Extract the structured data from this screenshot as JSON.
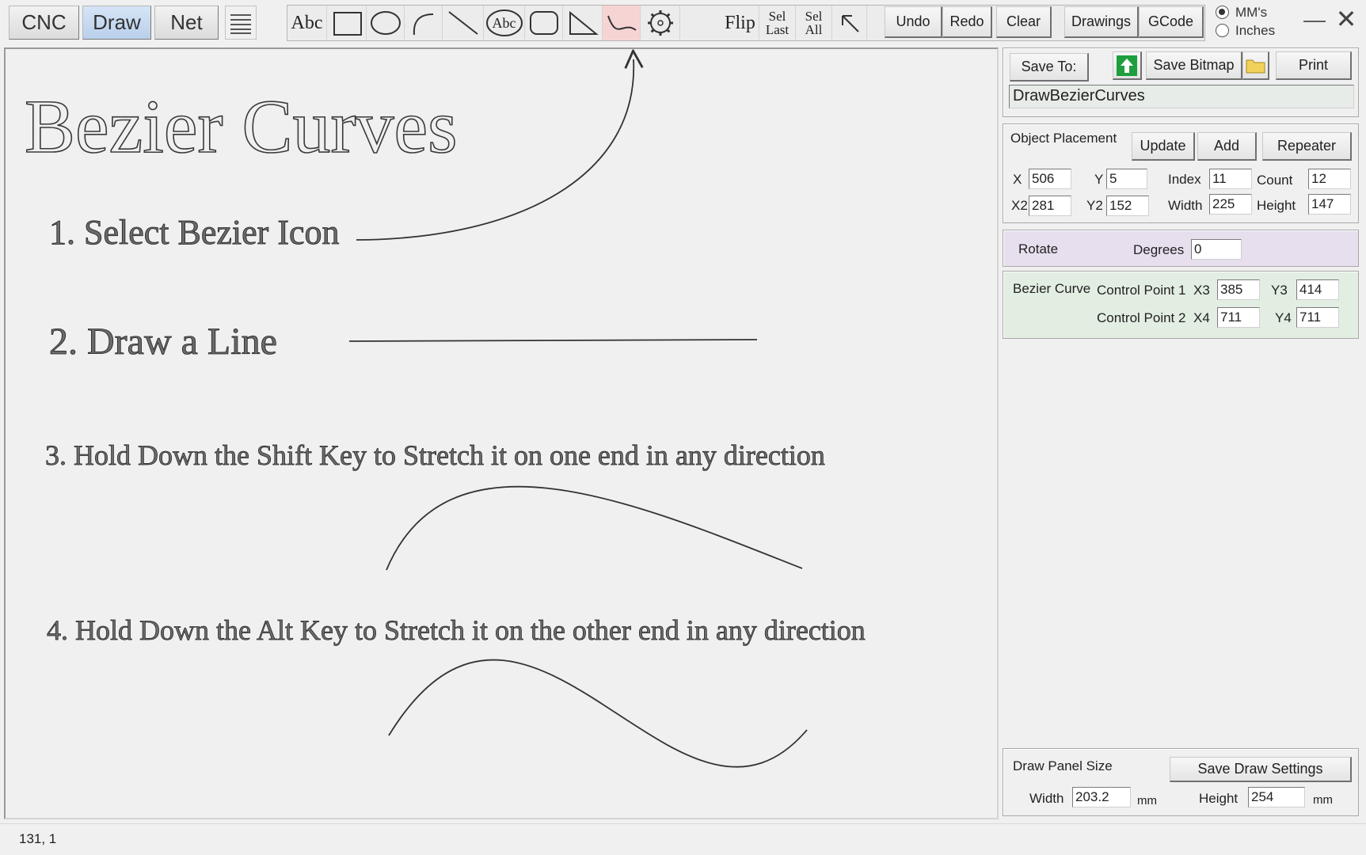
{
  "mode_tabs": [
    {
      "label": "CNC",
      "active": false
    },
    {
      "label": "Draw",
      "active": true
    },
    {
      "label": "Net",
      "active": false
    }
  ],
  "tools": {
    "text_tool_label": "Abc",
    "circle_text_label": "Abc",
    "flip_label": "Flip",
    "sel_last_line1": "Sel",
    "sel_last_line2": "Last",
    "sel_all_line1": "Sel",
    "sel_all_line2": "All",
    "active_tool": "bezier-tool",
    "active_color": "#f6d4d4"
  },
  "toolbar_buttons": {
    "undo": "Undo",
    "redo": "Redo",
    "clear": "Clear",
    "drawings": "Drawings",
    "gcode": "GCode"
  },
  "units": {
    "mms_label": "MM's",
    "inches_label": "Inches",
    "selected": "mms"
  },
  "canvas": {
    "title": "Bezier Curves",
    "step1": "1. Select Bezier Icon",
    "step2": "2. Draw a Line",
    "step3": "3.  Hold Down the Shift Key to Stretch it on one end in any direction",
    "step4": "4.  Hold Down the Alt Key to Stretch it on the other end in any direction"
  },
  "save_bar": {
    "save_to_label": "Save To:",
    "save_bitmap_label": "Save Bitmap",
    "print_label": "Print",
    "filename": "DrawBezierCurves",
    "upload_color": "#1e9e3e"
  },
  "object_placement": {
    "title": "Object Placement",
    "update_label": "Update",
    "add_label": "Add",
    "repeater_label": "Repeater",
    "x_label": "X",
    "x_value": "506",
    "y_label": "Y",
    "y_value": "5",
    "index_label": "Index",
    "index_value": "11",
    "count_label": "Count",
    "count_value": "12",
    "x2_label": "X2",
    "x2_value": "281",
    "y2_label": "Y2",
    "y2_value": "152",
    "width_label": "Width",
    "width_value": "225",
    "height_label": "Height",
    "height_value": "147"
  },
  "rotate": {
    "title": "Rotate",
    "degrees_label": "Degrees",
    "degrees_value": "0",
    "bg_color": "#e7dfee"
  },
  "bezier": {
    "title": "Bezier Curve",
    "cp1_label": "Control Point 1",
    "cp2_label": "Control Point 2",
    "x3_label": "X3",
    "x3_value": "385",
    "y3_label": "Y3",
    "y3_value": "414",
    "x4_label": "X4",
    "x4_value": "711",
    "y4_label": "Y4",
    "y4_value": "711",
    "bg_color": "#e3eee3"
  },
  "draw_panel": {
    "title": "Draw Panel Size",
    "save_settings_label": "Save Draw Settings",
    "width_label": "Width",
    "width_value": "203.2",
    "width_unit": "mm",
    "height_label": "Height",
    "height_value": "254",
    "height_unit": "mm"
  },
  "status": {
    "coords": "131, 1"
  }
}
